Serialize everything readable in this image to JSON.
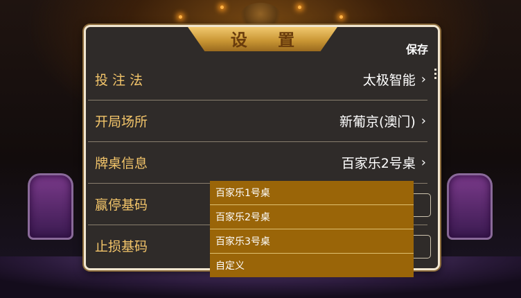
{
  "dialog": {
    "title": "设 置",
    "save_label": "保存",
    "rows": [
      {
        "label": "投 注 法",
        "value": "太极智能",
        "chevron": "›"
      },
      {
        "label": "开局场所",
        "value": "新葡京(澳门)",
        "chevron": "›"
      },
      {
        "label": "牌桌信息",
        "value": "百家乐2号桌",
        "chevron": "›"
      },
      {
        "label": "赢停基码",
        "value": ""
      },
      {
        "label": "止损基码",
        "value": ""
      }
    ]
  },
  "dropdown": {
    "options": [
      "百家乐1号桌",
      "百家乐2号桌",
      "百家乐3号桌",
      "自定义"
    ]
  },
  "colors": {
    "accent_gold": "#f3c56a",
    "dropdown_bg": "#9a6508",
    "panel_bg": "#2f2b29"
  }
}
